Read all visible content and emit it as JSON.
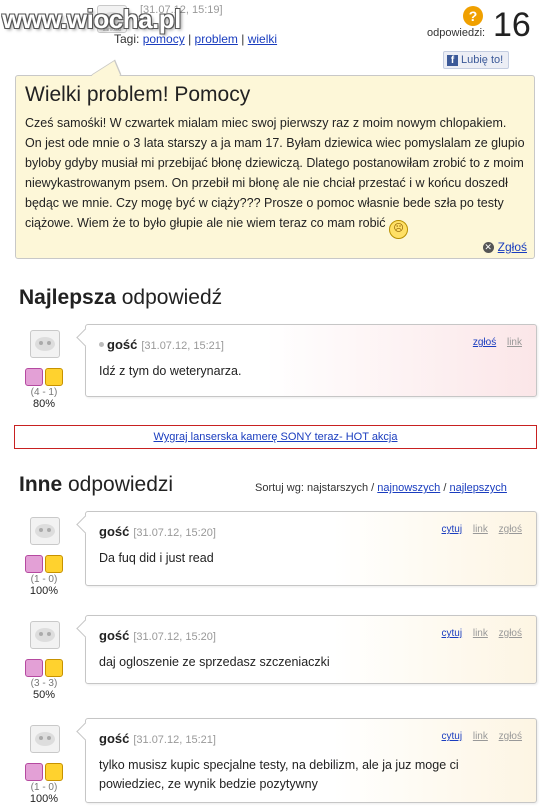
{
  "watermark": "www.wiocha.pl",
  "header": {
    "date": "[31.07.12, 15:19]",
    "tags_prefix": "Tagi:",
    "tags": [
      "pomocy",
      "problem",
      "wielki"
    ],
    "answers_label": "odpowiedzi:",
    "answers_count": "16",
    "like_label": "Lubię to!",
    "avatar_caption": "samoski"
  },
  "question": {
    "title": "Wielki problem! Pomocy",
    "text": "Cześ samośki! W czwartek mialam miec swoj pierwszy raz z moim nowym chlopakiem. On jest ode mnie o 3 lata starszy a ja mam 17. Byłam dziewica wiec pomyslalam ze glupio byloby gdyby musiał mi przebijać błonę dziewiczą. Dlatego postanowiłam zrobić to z moim niewykastrowanym psem. On przebił mi błonę ale nie chciał przestać i w końcu doszedł będąc we mnie. Czy mogę być w ciąży??? Prosze o pomoc własnie bede szła po testy ciążowe. Wiem że to było głupie ale nie wiem teraz co mam robić",
    "report_label": "Zgłoś"
  },
  "best_answer": {
    "heading_bold": "Najlepsza",
    "heading_rest": " odpowiedź",
    "user": "gość",
    "date": "[31.07.12, 15:21]",
    "report_link": "zgłoś",
    "link_link": "link",
    "text": "Idź z tym do weterynarza.",
    "votes_diff": "(4 - 1)",
    "votes_pct": "80%"
  },
  "ad": {
    "text": "Wygraj lanserska kamerę SONY teraz- HOT akcja"
  },
  "other_answers": {
    "heading_bold": "Inne",
    "heading_rest": " odpowiedzi",
    "sort_label": "Sortuj wg: najstarszych /",
    "sort_newest": "najnowszych",
    "sort_sep": "/",
    "sort_best": "najlepszych",
    "items": [
      {
        "user": "gość",
        "date": "[31.07.12, 15:20]",
        "text": "Da fuq did i just read",
        "votes_diff": "(1 - 0)",
        "votes_pct": "100%"
      },
      {
        "user": "gość",
        "date": "[31.07.12, 15:20]",
        "text": "daj ogloszenie ze sprzedasz szczeniaczki",
        "votes_diff": "(3 - 3)",
        "votes_pct": "50%"
      },
      {
        "user": "gość",
        "date": "[31.07.12, 15:21]",
        "text": "tylko musisz kupic specjalne testy, na debilizm, ale ja juz moge ci powiedziec, ze wynik bedzie pozytywny",
        "votes_diff": "(1 - 0)",
        "votes_pct": "100%"
      }
    ],
    "quote_link": "cytuj",
    "link_link": "link",
    "report_link": "zgłoś"
  },
  "colors": {
    "question_bg": "#fdf7d8",
    "ad_border": "#c82121",
    "link": "#1a3dbf"
  }
}
